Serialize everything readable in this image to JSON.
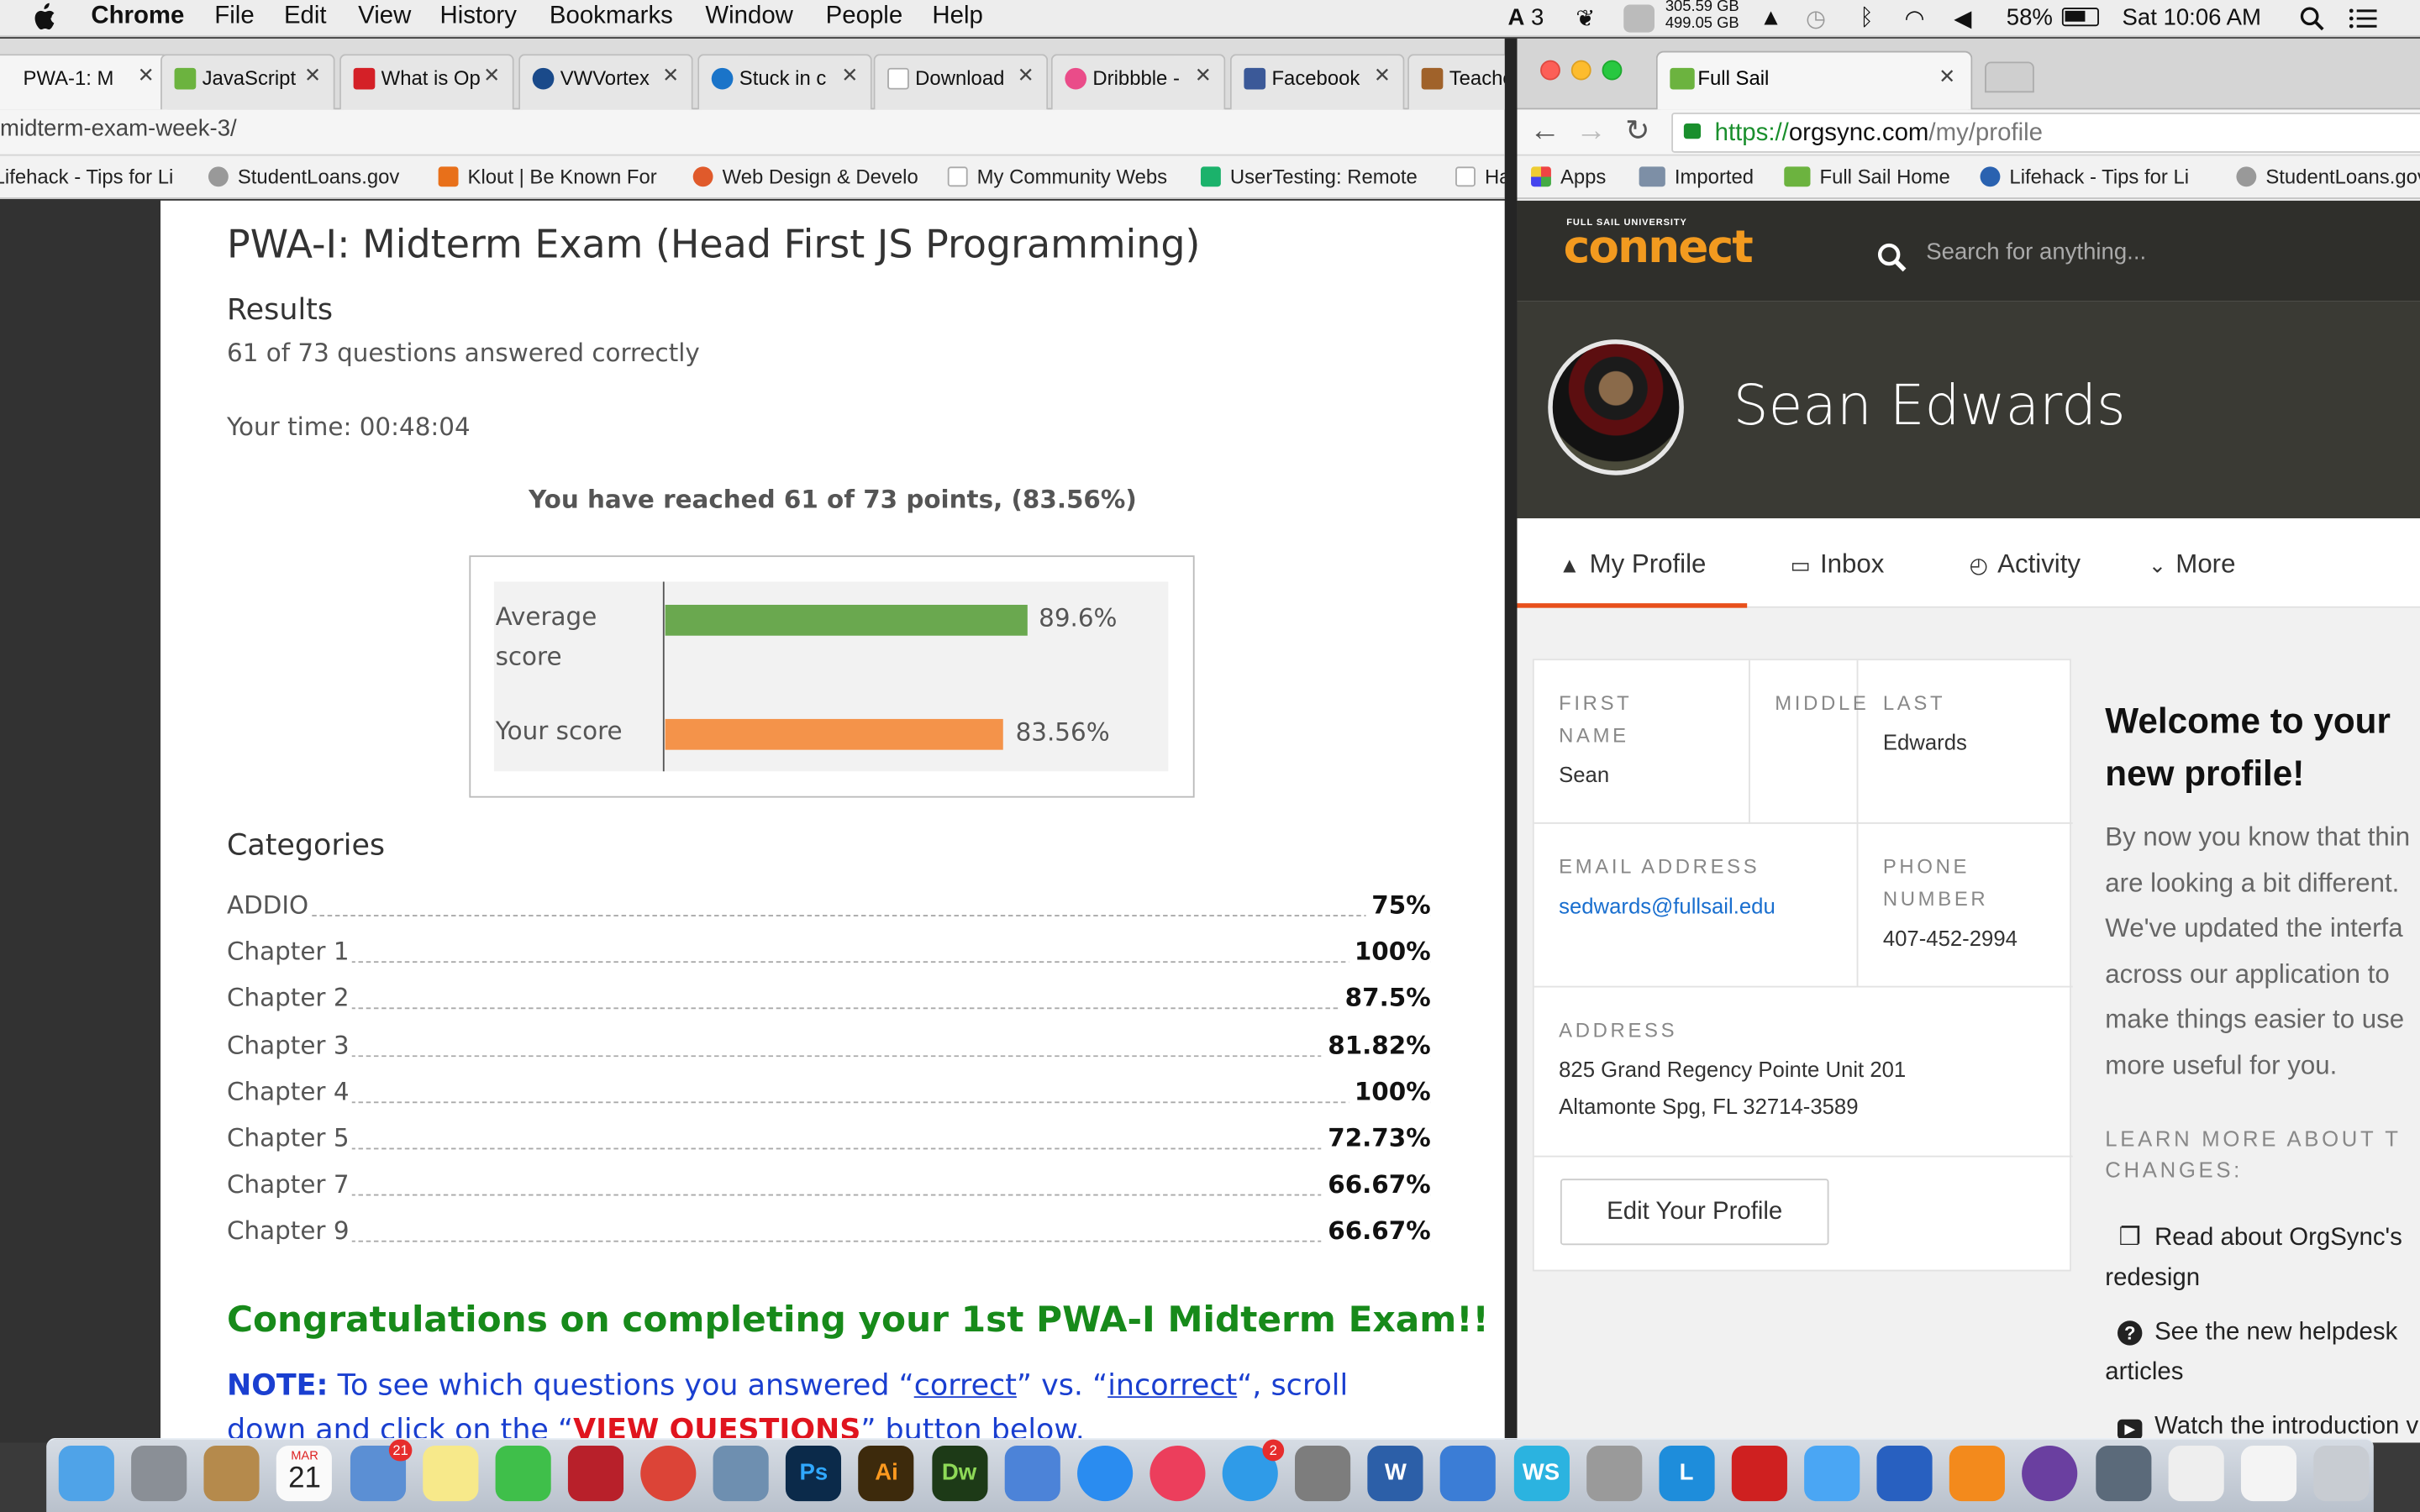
{
  "menubar": {
    "app": "Chrome",
    "menus": [
      "File",
      "Edit",
      "View",
      "History",
      "Bookmarks",
      "Window",
      "People",
      "Help"
    ],
    "tray": {
      "adobe_count": "3",
      "disk_used": "305.59 GB",
      "disk_total": "499.05 GB",
      "battery": "58%",
      "clock": "Sat 10:06 AM"
    }
  },
  "left_browser": {
    "tabs": [
      {
        "label": "PWA-1: M",
        "color": "#c63b2e"
      },
      {
        "label": "JavaScript",
        "color": "#6cb33f"
      },
      {
        "label": "What is Op",
        "color": "#d42027"
      },
      {
        "label": "VWVortex",
        "color": "#1a4a8a"
      },
      {
        "label": "Stuck in c",
        "color": "#1a74c9"
      },
      {
        "label": "Download",
        "color": "#d9d9d9"
      },
      {
        "label": "Dribbble -",
        "color": "#ea4c89"
      },
      {
        "label": "Facebook",
        "color": "#3b5998"
      },
      {
        "label": "Teacher",
        "color": "#a0622a"
      }
    ],
    "address": "midterm-exam-week-3/",
    "bookmarks": [
      {
        "label": "Lifehack - Tips for Li",
        "color": "#888"
      },
      {
        "label": "StudentLoans.gov",
        "color": "#777"
      },
      {
        "label": "Klout | Be Known For",
        "color": "#e8701a"
      },
      {
        "label": "Web Design & Develo",
        "color": "#e05a2b"
      },
      {
        "label": "My Community Webs",
        "color": "#ddd"
      },
      {
        "label": "UserTesting: Remote",
        "color": "#1bb26b"
      },
      {
        "label": "Ha",
        "color": "#ddd"
      }
    ]
  },
  "quiz": {
    "title": "PWA-I: Midterm Exam (Head First JS Programming)",
    "results_heading": "Results",
    "answered": "61 of 73 questions answered correctly",
    "time": "Your time: 00:48:04",
    "reached": "You have reached 61 of 73 points, (83.56%)",
    "categories_heading": "Categories",
    "categories": [
      {
        "label": "ADDIO",
        "value": "75%"
      },
      {
        "label": "Chapter 1",
        "value": "100%"
      },
      {
        "label": "Chapter 2",
        "value": "87.5%"
      },
      {
        "label": "Chapter 3",
        "value": "81.82%"
      },
      {
        "label": "Chapter 4",
        "value": "100%"
      },
      {
        "label": "Chapter 5",
        "value": "72.73%"
      },
      {
        "label": "Chapter 7",
        "value": "66.67%"
      },
      {
        "label": "Chapter 9",
        "value": "66.67%"
      }
    ],
    "congrats": "Congratulations on completing your 1st PWA-I Midterm Exam!!",
    "note_lead": "NOTE:",
    "note_1": " To see which questions you answered “",
    "note_correct": "correct",
    "note_2": "” vs. “",
    "note_incorrect": "incorrect",
    "note_3": "“, scroll down and click on the “",
    "note_view": "VIEW QUESTIONS",
    "note_4": "” button below."
  },
  "chart_data": {
    "type": "bar",
    "orientation": "horizontal",
    "categories": [
      "Average score",
      "Your score"
    ],
    "values": [
      89.6,
      83.56
    ],
    "value_labels": [
      "89.6%",
      "83.56%"
    ],
    "colors": [
      "#6aa84f",
      "#f4934a"
    ],
    "xlim": [
      0,
      100
    ],
    "grid": false
  },
  "right_browser": {
    "tab_label": "Full Sail",
    "url_scheme": "https://",
    "url_host": "orgsync.com",
    "url_path": "/my/profile",
    "bookmarks": [
      "Apps",
      "Imported",
      "Full Sail Home",
      "Lifehack - Tips for Li",
      "StudentLoans.gov"
    ]
  },
  "connect": {
    "logo_small": "FULL SAIL UNIVERSITY",
    "logo_main": "connect",
    "search_placeholder": "Search for anything...",
    "user_name": "Sean Edwards",
    "tabs": [
      "My Profile",
      "Inbox",
      "Activity",
      "More"
    ],
    "fields": {
      "first_label": "FIRST NAME",
      "first_value": "Sean",
      "middle_label": "MIDDLE",
      "last_label": "LAST",
      "last_value": "Edwards",
      "email_label": "EMAIL ADDRESS",
      "email_value": "sedwards@fullsail.edu",
      "phone_label": "PHONE NUMBER",
      "phone_value": "407-452-2994",
      "address_label": "ADDRESS",
      "address_line1": "825 Grand Regency Pointe Unit 201",
      "address_line2": "Altamonte Spg, FL 32714-3589"
    },
    "edit_button": "Edit Your Profile",
    "welcome_title": "Welcome to your new profile!",
    "welcome_lines": [
      "By now you know that thin",
      "are looking a bit different.",
      "We've updated the interfa",
      "across our application to",
      "make things easier to use",
      "more useful for you."
    ],
    "learn_more": "LEARN MORE ABOUT T CHANGES:",
    "links": [
      {
        "line1": "Read about OrgSync's",
        "line2": "redesign"
      },
      {
        "line1": "See the new helpdesk",
        "line2": "articles"
      },
      {
        "line1": "Watch the introduction v",
        "line2": ""
      }
    ]
  },
  "dock": {
    "calendar_month": "MAR",
    "calendar_day": "21",
    "badge_photos": "21",
    "badge_appstore": "2",
    "apps": [
      "finder",
      "launchpad",
      "contacts",
      "calendar",
      "preview",
      "notes",
      "facetime",
      "photo-booth",
      "chrome",
      "iphoto",
      "photoshop",
      "illustrator",
      "dreamweaver",
      "keynote",
      "safari",
      "itunes",
      "app-store",
      "system-preferences",
      "word",
      "wunderlist",
      "webstorm",
      "calculator",
      "lync",
      "acrobat",
      "messages",
      "apple-configurator",
      "vlc",
      "github",
      "automator",
      "downloads",
      "documents",
      "trash"
    ],
    "letters": {
      "photoshop": "Ps",
      "illustrator": "Ai",
      "dreamweaver": "Dw",
      "word": "W",
      "webstorm": "WS",
      "lync": "L"
    }
  }
}
